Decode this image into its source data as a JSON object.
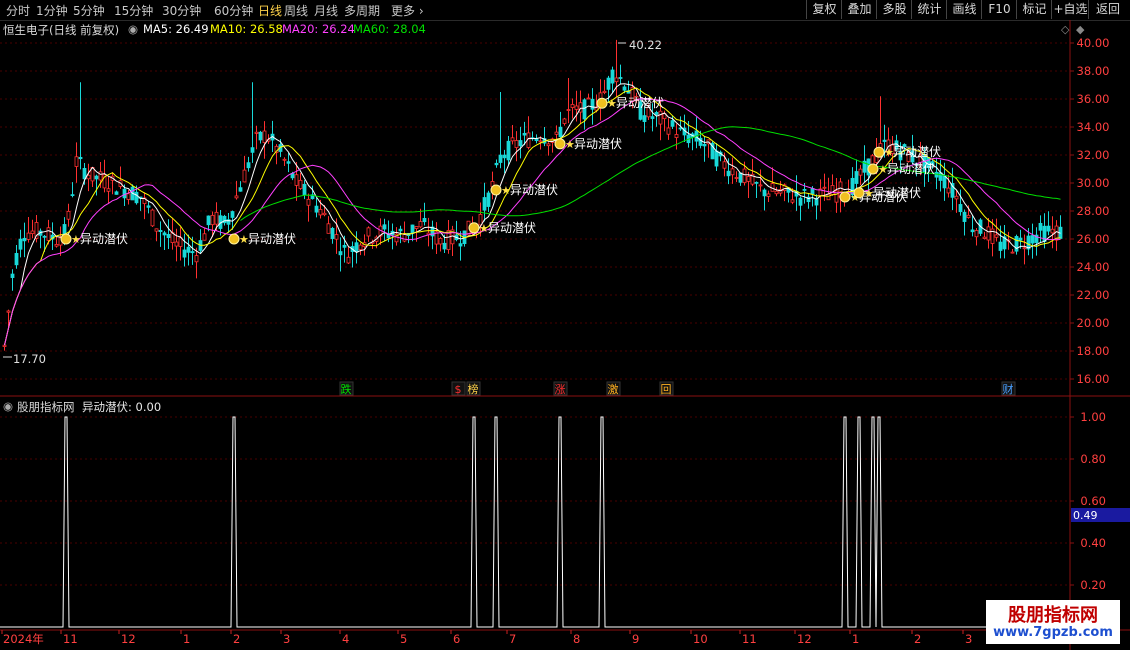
{
  "toolbar": {
    "timeframes": [
      "分时",
      "1分钟",
      "5分钟",
      "15分钟",
      "30分钟",
      "60分钟",
      "日线",
      "周线",
      "月线",
      "多周期",
      "更多"
    ],
    "active_timeframe": "日线",
    "buttons": [
      "复权",
      "叠加",
      "多股",
      "统计",
      "画线",
      "F10",
      "标记",
      "+自选",
      "返回"
    ]
  },
  "stock_title": "恒生电子(日线 前复权)",
  "ma": [
    {
      "label": "MA5: 26.49",
      "color": "#ffffff"
    },
    {
      "label": "MA10: 26.58",
      "color": "#ffff00"
    },
    {
      "label": "MA20: 26.24",
      "color": "#ff40ff"
    },
    {
      "label": "MA60: 28.04",
      "color": "#00e000"
    }
  ],
  "price_axis": [
    "40.00",
    "38.00",
    "36.00",
    "34.00",
    "32.00",
    "30.00",
    "28.00",
    "26.00",
    "24.00",
    "22.00",
    "20.00",
    "18.00",
    "16.00"
  ],
  "high_label": "40.22",
  "low_label": "17.70",
  "signal_label": "异动潜伏",
  "event_markers": [
    {
      "text": "跌",
      "color": "#00e000",
      "month": "4"
    },
    {
      "text": "$",
      "color": "#ff3030",
      "month": "6"
    },
    {
      "text": "榜",
      "color": "#ffd24a",
      "month": "6"
    },
    {
      "text": "涨",
      "color": "#ff3030",
      "month": "7"
    },
    {
      "text": "激",
      "color": "#ffb020",
      "month": "8"
    },
    {
      "text": "回",
      "color": "#ffb020",
      "month": "9"
    },
    {
      "text": "财",
      "color": "#4aa0ff",
      "month": "2"
    }
  ],
  "sub_title": "股朋指标网",
  "sub_indicator": "异动潜伏: 0.00",
  "sub_axis": [
    "1.00",
    "0.80",
    "0.60",
    "0.40",
    "0.20"
  ],
  "sub_current": "0.49",
  "date_axis": [
    "2024年",
    "11",
    "12",
    "1",
    "2",
    "3",
    "4",
    "5",
    "6",
    "7",
    "8",
    "9",
    "10",
    "11",
    "12",
    "1",
    "2",
    "3"
  ],
  "watermark": {
    "line1": "股朋指标网",
    "line2": "www.7gpzb.com"
  },
  "chart_data": {
    "type": "candlestick",
    "price_range": [
      16,
      40.22
    ],
    "low": 17.7,
    "high": 40.22,
    "ma_current": {
      "MA5": 26.49,
      "MA10": 26.58,
      "MA20": 26.24,
      "MA60": 28.04
    },
    "indicator": {
      "name": "异动潜伏",
      "value": 0.0,
      "range": [
        0,
        1
      ]
    }
  }
}
